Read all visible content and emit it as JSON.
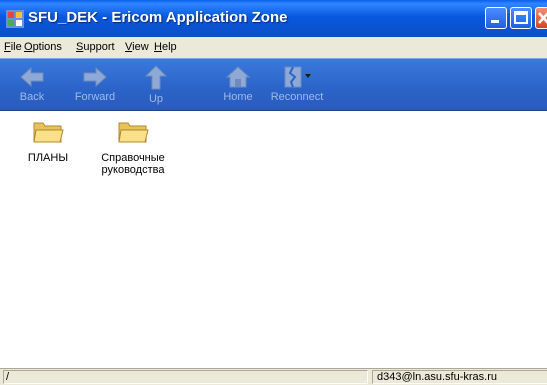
{
  "window": {
    "title": "SFU_DEK - Ericom Application Zone",
    "icon": "app-zone-icon",
    "controls": [
      "minimize-icon",
      "maximize-icon",
      "close-icon"
    ]
  },
  "menu": {
    "file": "File",
    "options": "Options",
    "support": "Support",
    "view": "View",
    "help": "Help"
  },
  "toolbar": {
    "back": "Back",
    "forward": "Forward",
    "up": "Up",
    "home": "Home",
    "reconnect": "Reconnect"
  },
  "folders": [
    {
      "line1": "ПЛАНЫ",
      "line2": ""
    },
    {
      "line1": "Справочные",
      "line2": "руководства"
    }
  ],
  "status": {
    "path": "/",
    "user": "d343@ln.asu.sfu-kras.ru"
  },
  "colors": {
    "titlebar": "#0a54d4",
    "toolbar": "#2b63c8",
    "folder": "#f7d774"
  }
}
